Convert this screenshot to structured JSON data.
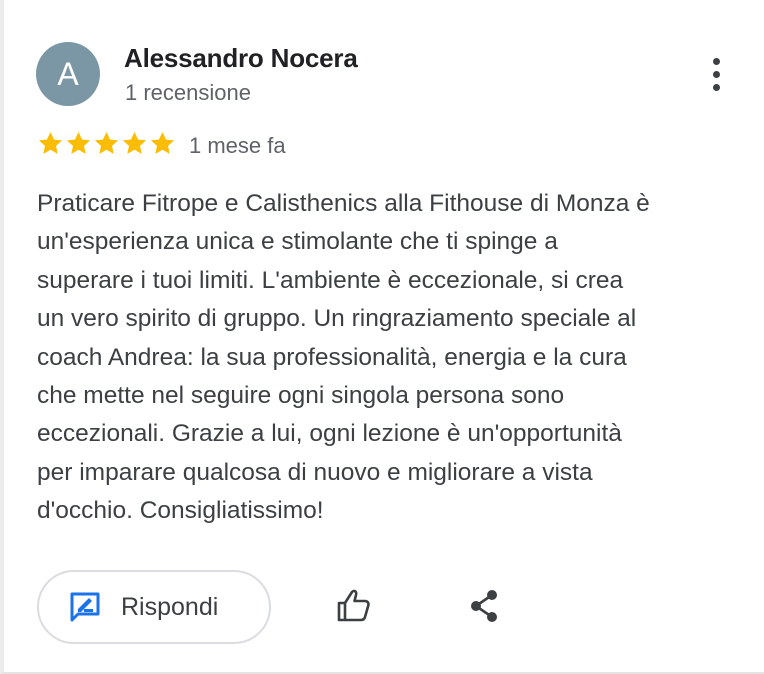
{
  "review": {
    "avatar_initial": "A",
    "author_name": "Alessandro Nocera",
    "review_count": "1 recensione",
    "rating": 5,
    "rating_max": 5,
    "time_ago": "1 mese fa",
    "text": "Praticare Fitrope e Calisthenics alla Fithouse di Monza è\nun'esperienza unica e stimolante che ti spinge a\nsuperare i tuoi limiti. L'ambiente è eccezionale, si crea\nun vero spirito di gruppo. Un ringraziamento speciale al\ncoach Andrea: la sua professionalità, energia e la cura\nche mette nel seguire ogni singola persona sono\neccezionali. Grazie a lui, ogni lezione è un'opportunità\nper imparare qualcosa di nuovo e migliorare a vista\nd'occhio. Consigliatissimo!"
  },
  "actions": {
    "reply_label": "Rispondi",
    "reply_icon": "reply-edit-icon",
    "like_icon": "thumb-up-icon",
    "share_icon": "share-icon",
    "more_icon": "more-vert-icon"
  },
  "colors": {
    "avatar_bg": "#7b97a6",
    "star": "#fbbc04",
    "reply_icon": "#1a73e8",
    "text_primary": "#202124",
    "text_secondary": "#5f6368"
  }
}
